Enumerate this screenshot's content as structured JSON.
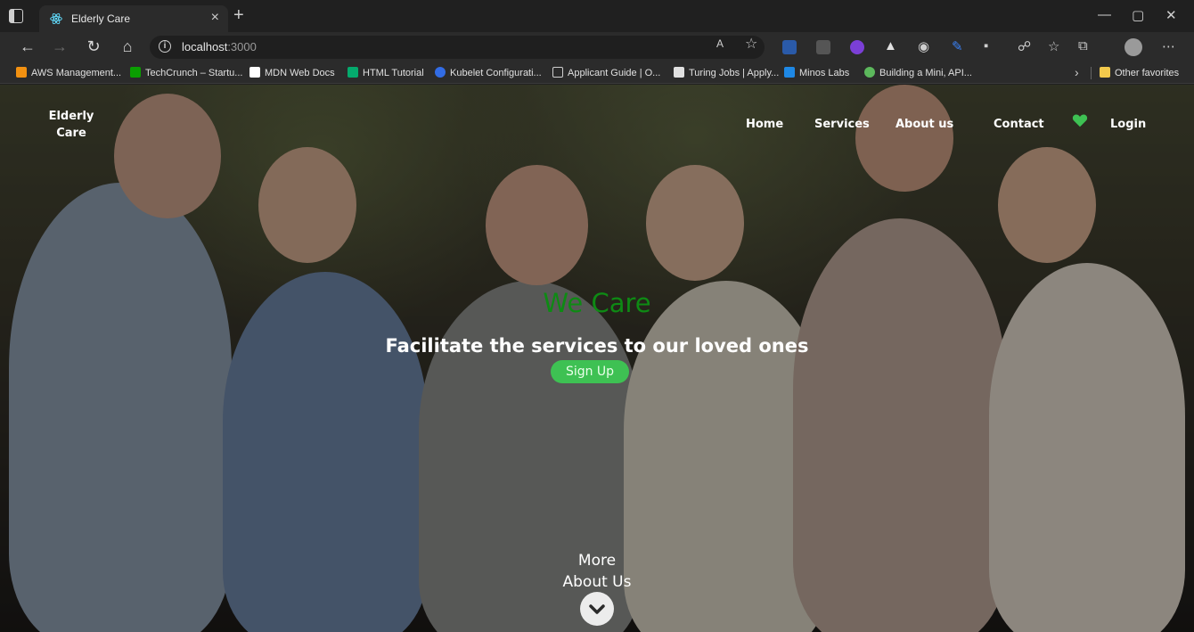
{
  "browser": {
    "tab_title": "Elderly Care",
    "url_host": "localhost",
    "url_port": ":3000",
    "read_aloud": "A",
    "bookmarks": [
      {
        "label": "AWS Management...",
        "icon": "aws-icon",
        "color": "#f29111"
      },
      {
        "label": "TechCrunch – Startu...",
        "icon": "techcrunch-icon",
        "color": "#0a9e01"
      },
      {
        "label": "MDN Web Docs",
        "icon": "mdn-icon",
        "color": "#ffffff"
      },
      {
        "label": "HTML Tutorial",
        "icon": "w3schools-icon",
        "color": "#04aa6d"
      },
      {
        "label": "Kubelet Configurati...",
        "icon": "kubernetes-icon",
        "color": "#326ce5"
      },
      {
        "label": "Applicant Guide | O...",
        "icon": "page-icon",
        "color": "#cfcfcf"
      },
      {
        "label": "Turing Jobs | Apply...",
        "icon": "turing-icon",
        "color": "#e0e0e0"
      },
      {
        "label": "Minos Labs",
        "icon": "minos-icon",
        "color": "#1e88e5"
      },
      {
        "label": "Building a Mini, API...",
        "icon": "leaf-icon",
        "color": "#5cb85c"
      }
    ],
    "other_favorites": "Other favorites"
  },
  "site": {
    "brand_line1": "Elderly",
    "brand_line2": "Care",
    "nav": {
      "home": "Home",
      "services": "Services",
      "about": "About us",
      "contact": "Contact",
      "login": "Login"
    },
    "hero": {
      "title": "We Care",
      "subtitle": "Facilitate the services to our loved ones",
      "signup": "Sign Up"
    },
    "more_line1": "More",
    "more_line2": "About Us"
  },
  "colors": {
    "accent_green": "#0e8a14",
    "signup_green": "#3ec153",
    "heart_green": "#3ec153"
  }
}
